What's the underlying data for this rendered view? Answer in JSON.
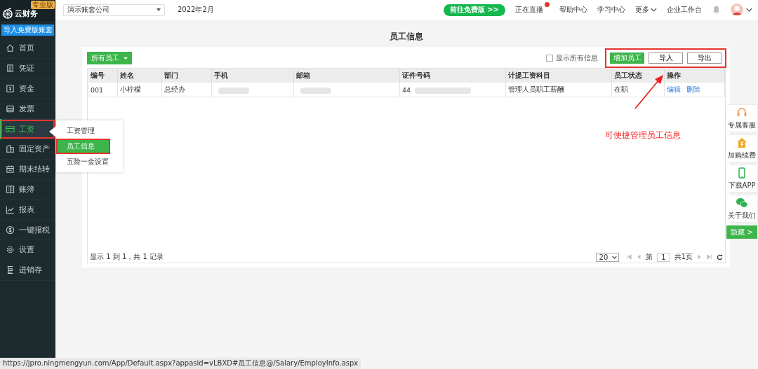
{
  "app": {
    "logo": "云财务",
    "edition": "专业版",
    "import_button": "导入免费版账套"
  },
  "sidebar": [
    {
      "label": "首页",
      "selected": false,
      "highlighted": false
    },
    {
      "label": "凭证",
      "selected": false,
      "highlighted": false
    },
    {
      "label": "资金",
      "selected": false,
      "highlighted": false
    },
    {
      "label": "发票",
      "selected": false,
      "highlighted": false
    },
    {
      "label": "工资",
      "selected": true,
      "highlighted": true
    },
    {
      "label": "固定资产",
      "selected": false,
      "highlighted": false
    },
    {
      "label": "期末结转",
      "selected": false,
      "highlighted": false
    },
    {
      "label": "账簿",
      "selected": false,
      "highlighted": false
    },
    {
      "label": "报表",
      "selected": false,
      "highlighted": false
    },
    {
      "label": "一键报税",
      "selected": false,
      "highlighted": false
    },
    {
      "label": "设置",
      "selected": false,
      "highlighted": false
    },
    {
      "label": "进销存",
      "selected": false,
      "highlighted": false
    }
  ],
  "submenu": [
    {
      "label": "工资管理",
      "selected": false,
      "highlighted": false
    },
    {
      "label": "员工信息",
      "selected": true,
      "highlighted": true
    },
    {
      "label": "五险一金设置",
      "selected": false,
      "highlighted": false
    }
  ],
  "topbar": {
    "company": "演示账套公司",
    "period": "2022年2月",
    "promo": "前往免费版 >>",
    "links": [
      {
        "label": "正在直播",
        "badge": true,
        "dropdown": false
      },
      {
        "label": "帮助中心",
        "badge": false,
        "dropdown": false
      },
      {
        "label": "学习中心",
        "badge": false,
        "dropdown": false
      },
      {
        "label": "更多",
        "badge": false,
        "dropdown": true
      },
      {
        "label": "企业工作台",
        "badge": false,
        "dropdown": false
      }
    ]
  },
  "page_title": "员工信息",
  "toolbar": {
    "filter": "所有员工",
    "show_all": {
      "label": "显示所有信息",
      "checked": false
    },
    "highlighted": true,
    "buttons": [
      {
        "label": "增加员工",
        "primary": true
      },
      {
        "label": "导入",
        "primary": false
      },
      {
        "label": "导出",
        "primary": false
      }
    ]
  },
  "table": {
    "columns": [
      "编号",
      "姓名",
      "部门",
      "手机",
      "邮箱",
      "证件号码",
      "计提工资科目",
      "员工状态",
      "操作"
    ],
    "rows": [
      {
        "cells": [
          {
            "kind": "text",
            "text": "001"
          },
          {
            "kind": "text",
            "text": "小柠檬"
          },
          {
            "kind": "text",
            "text": "总经办"
          },
          {
            "kind": "redacted"
          },
          {
            "kind": "redacted"
          },
          {
            "kind": "partial",
            "text": "44"
          },
          {
            "kind": "text",
            "text": "管理人员职工薪酬"
          },
          {
            "kind": "text",
            "text": "在职"
          },
          {
            "kind": "actions",
            "actions": [
              "编辑",
              "删除"
            ]
          }
        ]
      }
    ]
  },
  "footer": {
    "summary": "显示 1 到 1，共 1 记录",
    "page_size": "20",
    "page_label": "第",
    "page": "1",
    "total_pages": "共1页"
  },
  "annotation": {
    "text": "可便捷管理员工信息"
  },
  "side_tools": [
    {
      "label": "专属客服"
    },
    {
      "label": "加购续费"
    },
    {
      "label": "下载APP"
    },
    {
      "label": "关于我们"
    }
  ],
  "hide_button": "隐藏 >",
  "status_url": "https://jpro.ningmengyun.com/App/Default.aspx?appasid=vLBXD#员工信息@/Salary/EmployInfo.aspx"
}
